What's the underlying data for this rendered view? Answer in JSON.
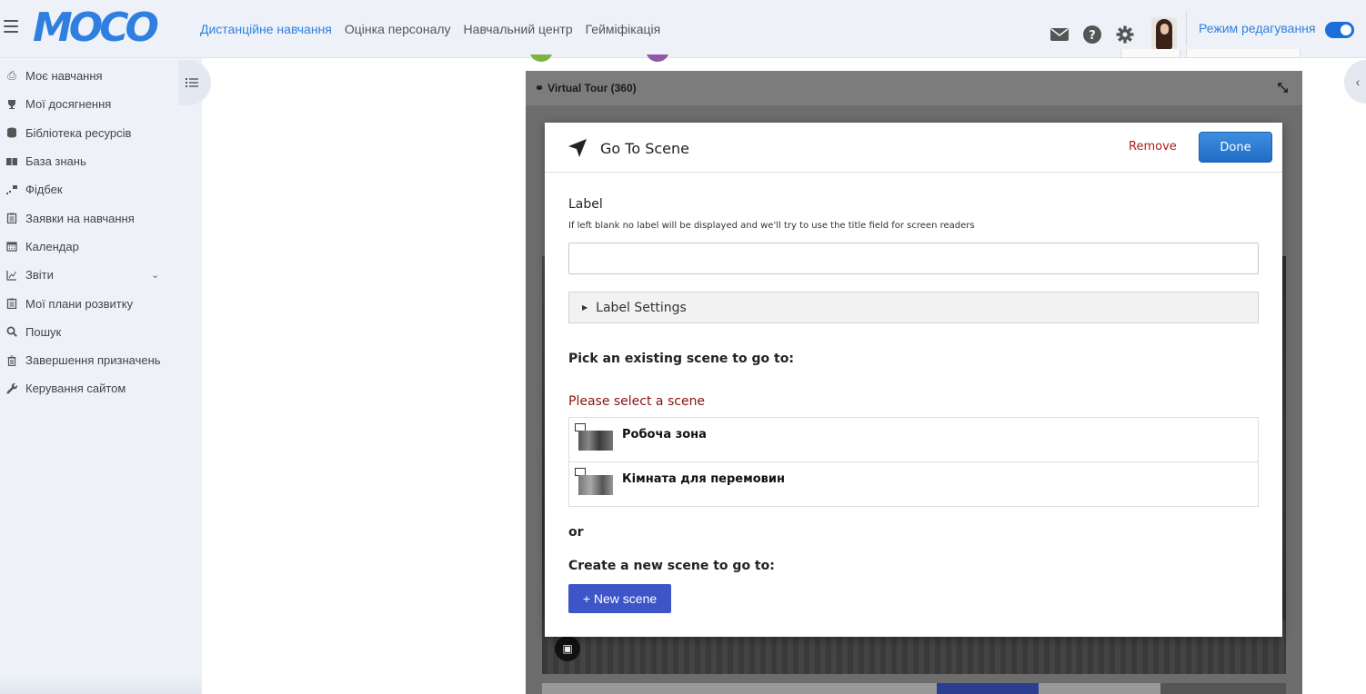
{
  "topbar": {
    "logo_text": "MOCO",
    "nav": [
      {
        "label": "Дистанційне навчання",
        "active": true
      },
      {
        "label": "Оцінка персоналу",
        "active": false
      },
      {
        "label": "Навчальний центр",
        "active": false
      },
      {
        "label": "Гейміфікація",
        "active": false
      }
    ],
    "icons": [
      "mail-icon",
      "help-icon",
      "gear-icon"
    ],
    "edit_mode_label": "Режим редагування",
    "edit_mode_on": true,
    "accent_color": "#2f7fe0"
  },
  "sidebar": {
    "items": [
      {
        "label": "Моє навчання",
        "icon": "learning-icon"
      },
      {
        "label": "Мої досягнення",
        "icon": "trophy-icon"
      },
      {
        "label": "Бібліотека ресурсів",
        "icon": "database-icon"
      },
      {
        "label": "База знань",
        "icon": "book-icon"
      },
      {
        "label": "Фідбек",
        "icon": "feedback-icon"
      },
      {
        "label": "Заявки на навчання",
        "icon": "clipboard-icon"
      },
      {
        "label": "Календар",
        "icon": "calendar-icon"
      },
      {
        "label": "Звіти",
        "icon": "chart-icon",
        "expandable": true
      },
      {
        "label": "Мої плани розвитку",
        "icon": "clipboard-icon"
      },
      {
        "label": "Пошук",
        "icon": "search-icon"
      },
      {
        "label": "Завершення призначень",
        "icon": "trash-icon"
      },
      {
        "label": "Керування сайтом",
        "icon": "wrench-icon"
      }
    ]
  },
  "editor": {
    "title": "Virtual Tour (360)"
  },
  "modal": {
    "title": "Go To Scene",
    "remove_label": "Remove",
    "done_label": "Done",
    "label_heading": "Label",
    "label_hint": "If left blank no label will be displayed and we'll try to use the title field for screen readers",
    "label_value": "",
    "label_settings": "Label Settings",
    "pick_heading": "Pick an existing scene to go to:",
    "error_text": "Please select a scene",
    "scenes": [
      {
        "name": "Робоча зона"
      },
      {
        "name": "Кімната для перемовин"
      }
    ],
    "or_text": "or",
    "create_heading": "Create a new scene to go to:",
    "new_scene_label": "+ New scene"
  }
}
